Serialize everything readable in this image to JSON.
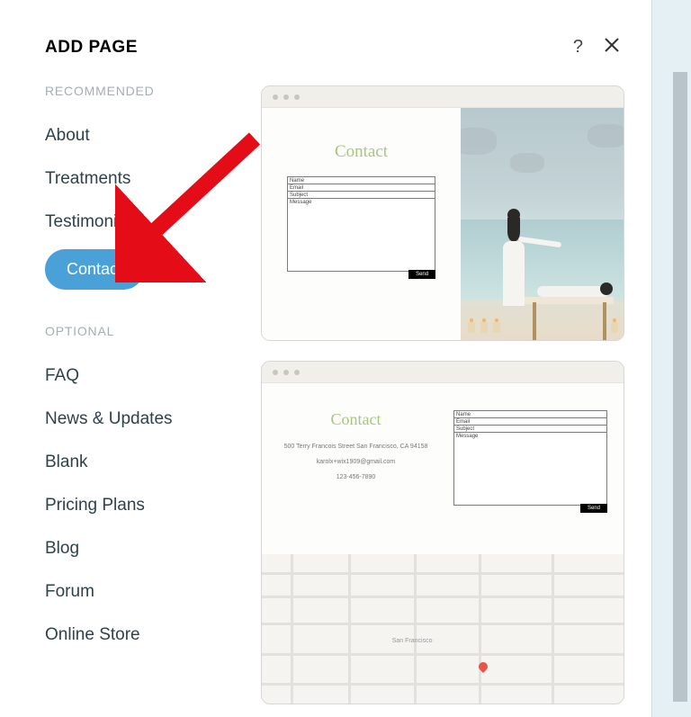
{
  "header": {
    "title": "ADD PAGE"
  },
  "sections": {
    "recommended_label": "RECOMMENDED",
    "optional_label": "OPTIONAL"
  },
  "recommended_items": [
    {
      "label": "About",
      "selected": false
    },
    {
      "label": "Treatments",
      "selected": false
    },
    {
      "label": "Testimonials",
      "selected": false
    },
    {
      "label": "Contact",
      "selected": true
    }
  ],
  "optional_items": [
    {
      "label": "FAQ"
    },
    {
      "label": "News & Updates"
    },
    {
      "label": "Blank"
    },
    {
      "label": "Pricing Plans"
    },
    {
      "label": "Blog"
    },
    {
      "label": "Forum"
    },
    {
      "label": "Online Store"
    }
  ],
  "preview1": {
    "heading": "Contact",
    "fields": {
      "name": "Name",
      "email": "Email",
      "subject": "Subject",
      "message": "Message"
    },
    "send": "Send"
  },
  "preview2": {
    "heading": "Contact",
    "address": "500 Terry Francois Street San Francisco, CA 94158",
    "email": "karolx+wix1909@gmail.com",
    "phone": "123-456-7890",
    "fields": {
      "name": "Name",
      "email": "Email",
      "subject": "Subject",
      "message": "Message"
    },
    "send": "Send",
    "map_city": "San Francisco"
  },
  "annotation": {
    "arrow_color": "#e30c17"
  }
}
